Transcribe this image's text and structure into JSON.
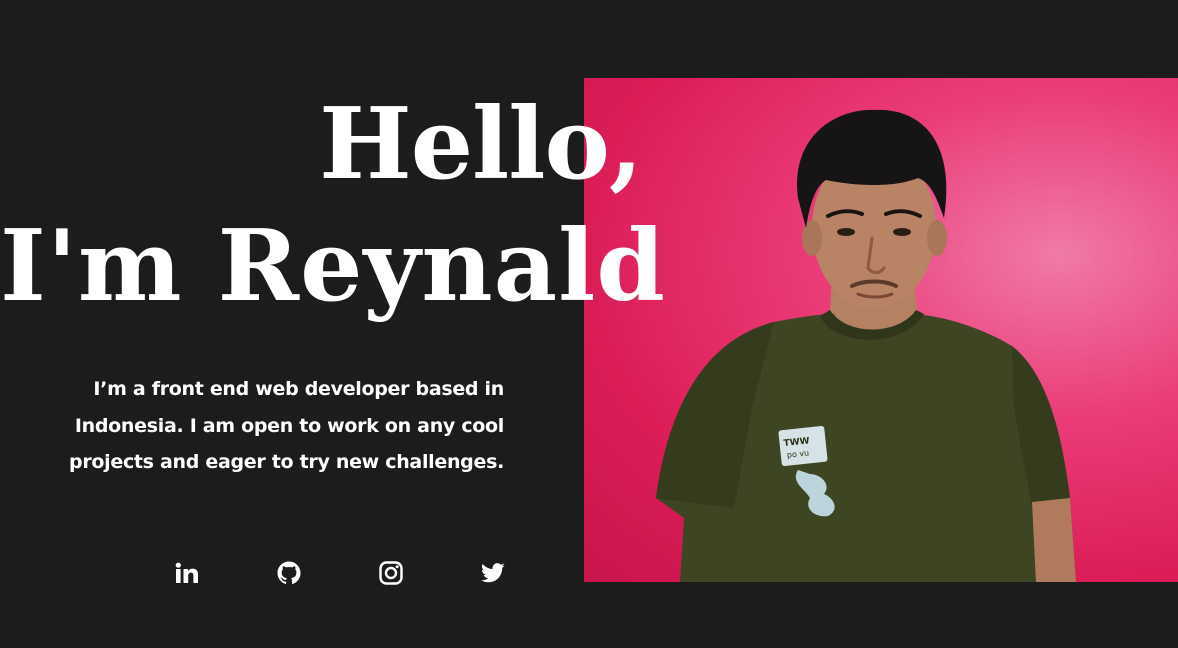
{
  "hero": {
    "title_line1": "Hello,",
    "title_line2": "I'm Reynald",
    "intro": "I’m a front end web developer based in Indonesia. I am open to work on any cool projects and eager to try new challenges."
  },
  "photo": {
    "subject": "portrait-photo",
    "background_color": "#dc1d57",
    "shirt_color": "#3d4422"
  },
  "socials": [
    {
      "icon": "linkedin-icon"
    },
    {
      "icon": "github-icon"
    },
    {
      "icon": "instagram-icon"
    },
    {
      "icon": "twitter-icon"
    }
  ],
  "colors": {
    "background": "#1c1c1c",
    "text": "#ffffff",
    "accent": "#dc1d57"
  }
}
